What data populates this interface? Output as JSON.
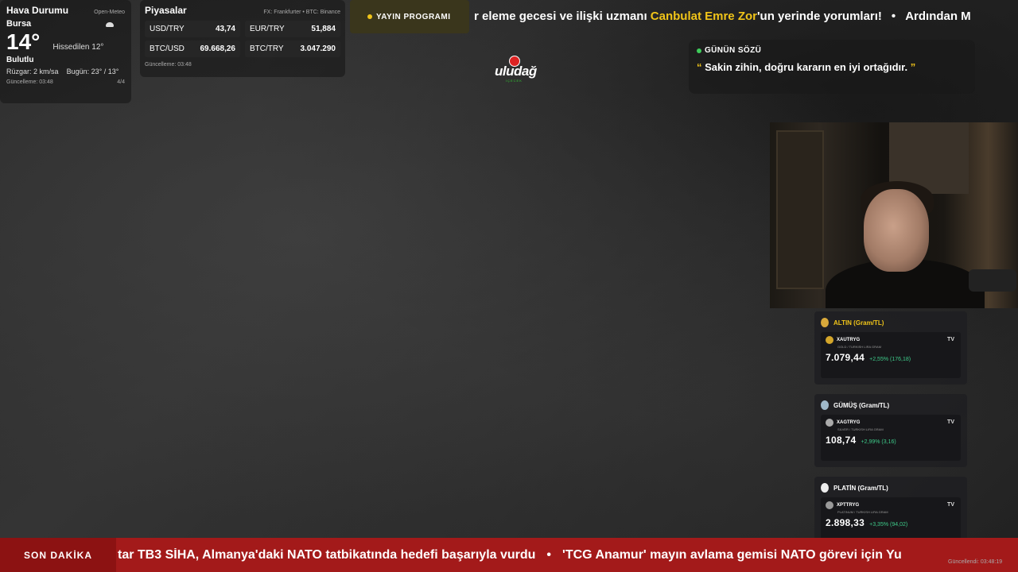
{
  "weather": {
    "title": "Hava Durumu",
    "source": "Open-Meteo",
    "city": "Bursa",
    "icon": "cloud-icon",
    "temperature": "14°",
    "feels_like": "Hissedilen 12°",
    "condition": "Bulutlu",
    "wind_label": "Rüzgar:",
    "wind_value": "2 km/sa",
    "today_label": "Bugün:",
    "today_value": "23° / 13°",
    "updated": "Güncelleme: 03:48",
    "page": "4/4"
  },
  "markets": {
    "title": "Piyasalar",
    "source": "FX: Frankfurter • BTC: Binance",
    "items": [
      {
        "label": "USD/TRY",
        "value": "43,74"
      },
      {
        "label": "EUR/TRY",
        "value": "51,884"
      },
      {
        "label": "BTC/USD",
        "value": "69.668,26"
      },
      {
        "label": "BTC/TRY",
        "value": "3.047.290"
      }
    ],
    "updated": "Güncelleme: 03:48"
  },
  "program": {
    "label": "YAYIN PROGRAMI"
  },
  "top_ticker": {
    "part1": "r eleme gecesi ve ilişki uzmanı ",
    "highlight": "Canbulat Emre Zor",
    "part2": "'un yerinde yorumları!",
    "separator": "•",
    "part3": "Ardından M"
  },
  "logo": {
    "text": "uludağ",
    "subtext": "İÇECEK"
  },
  "quote": {
    "title": "GÜNÜN SÖZÜ",
    "open_mark": "“",
    "text": " Sakin zihin, doğru kararın en iyi ortağıdır. ",
    "close_mark": "”"
  },
  "metals": [
    {
      "title": "ALTIN (Gram/TL)",
      "symbol": "XAUTRYG",
      "desc": "GOLD / TURKISH LIRA GRAM",
      "price": "7.079,44",
      "change": "+2,55% (176,18)",
      "medal_color": "#d9a93b",
      "coin_color": "#d4a62a"
    },
    {
      "title": "GÜMÜŞ (Gram/TL)",
      "symbol": "XAGTRYG",
      "desc": "SILVER / TURKISH LIRA GRAM",
      "price": "108,74",
      "change": "+2,99% (3,16)",
      "medal_color": "#9fb8c9",
      "coin_color": "#aaaaaa"
    },
    {
      "title": "PLATİN (Gram/TL)",
      "symbol": "XPTTRYG",
      "desc": "PLATINUM / TURKISH LIRA GRAM",
      "price": "2.898,33",
      "change": "+3,35% (94,02)",
      "medal_color": "#eeeeee",
      "coin_color": "#999999"
    }
  ],
  "metals_updated": "Güncellendi: 03:48:19",
  "tv_icon": "TV",
  "breaking": {
    "label": "SON DAKİKA",
    "text1": "tar TB3 SİHA, Almanya'daki NATO tatbikatında hedefi başarıyla vurdu",
    "separator": "•",
    "text2": "'TCG Anamur' mayın avlama gemisi NATO görevi için Yu"
  },
  "colors": {
    "accent_yellow": "#f0c419",
    "live_green": "#3ecb5a",
    "breaking_red": "#a31a1a",
    "positive": "#3ecb8a"
  }
}
